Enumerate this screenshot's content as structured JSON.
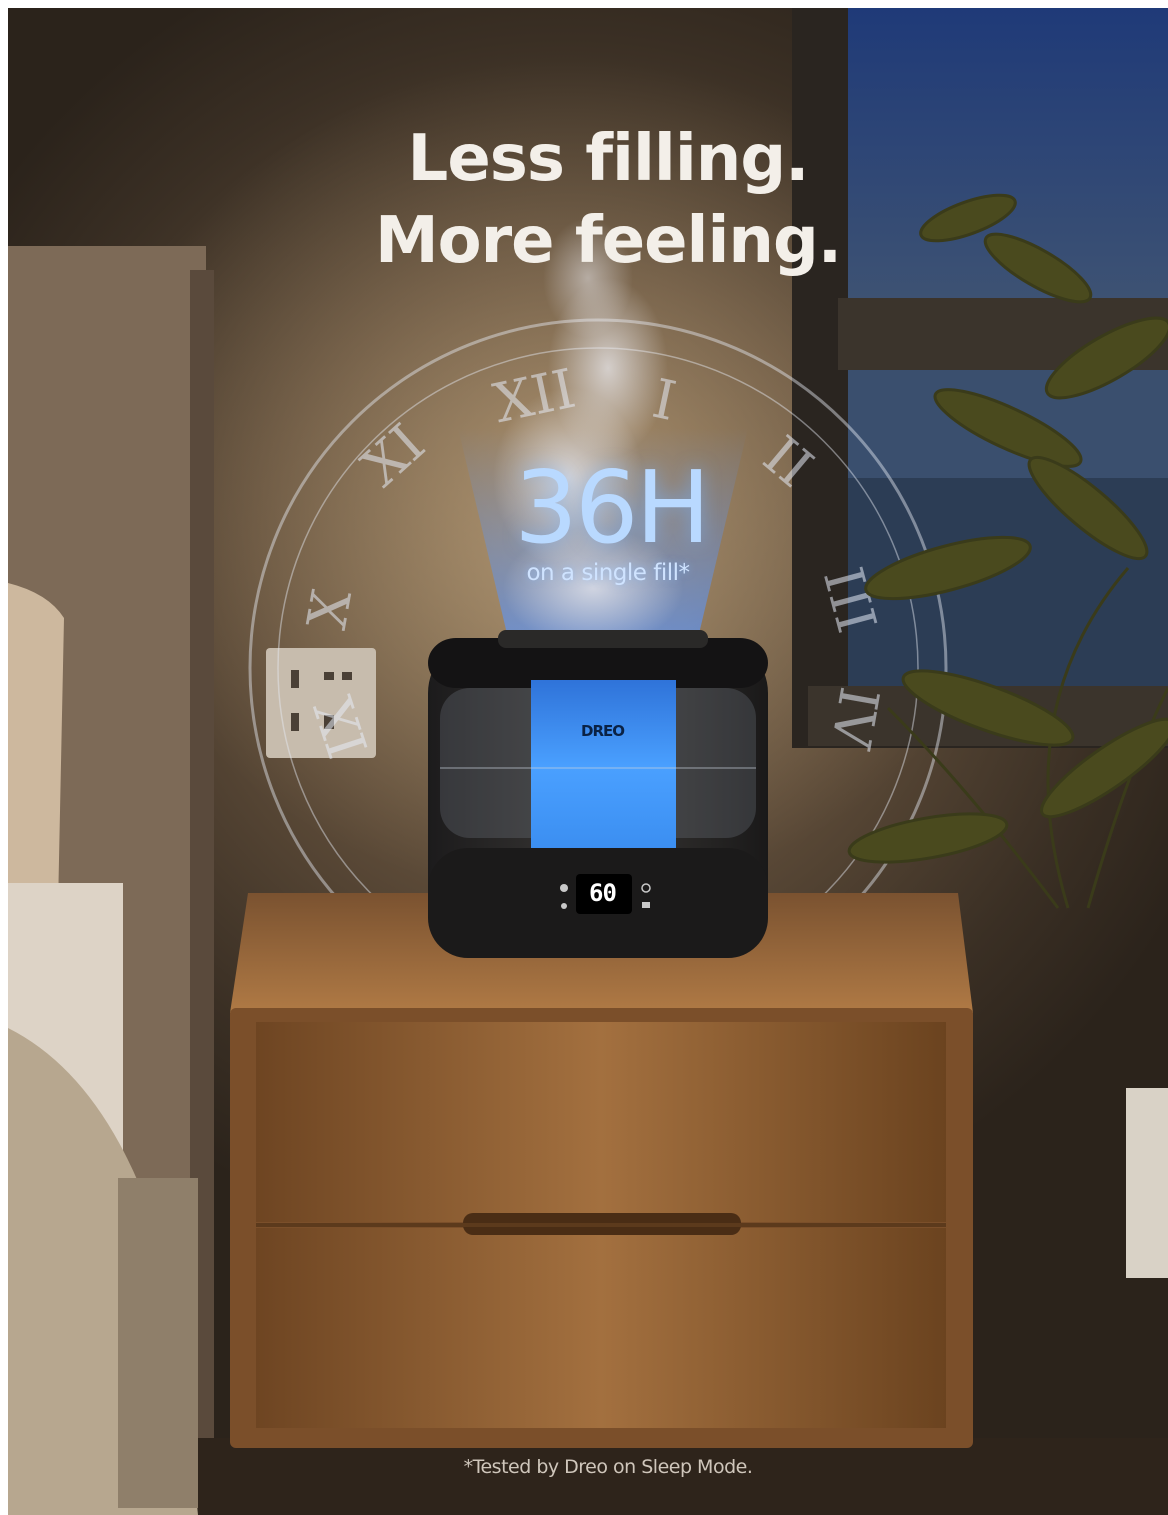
{
  "headline": {
    "line1": "Less filling.",
    "line2": "More feeling."
  },
  "stat": {
    "value": "36H",
    "caption": "on a single fill*"
  },
  "product": {
    "brand": "DREO",
    "display_value": "60"
  },
  "footnote": "*Tested by Dreo on Sleep Mode.",
  "colors": {
    "accent_blue": "#3a8df0",
    "wood": "#9a6a3c",
    "wall": "#6a5641"
  }
}
